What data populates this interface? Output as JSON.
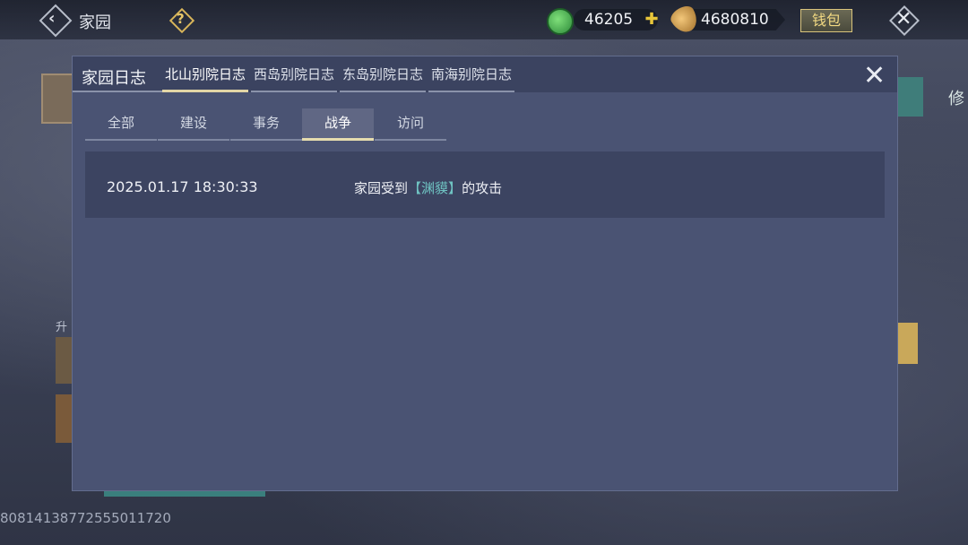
{
  "topbar": {
    "home_title": "家园",
    "jade_amount": "46205",
    "coin_amount": "4680810",
    "wallet_label": "钱包"
  },
  "dialog": {
    "title": "家园日志",
    "top_tabs": [
      {
        "label": "北山别院日志",
        "active": true
      },
      {
        "label": "西岛别院日志",
        "active": false
      },
      {
        "label": "东岛别院日志",
        "active": false
      },
      {
        "label": "南海别院日志",
        "active": false
      }
    ],
    "sub_tabs": [
      {
        "label": "全部",
        "active": false
      },
      {
        "label": "建设",
        "active": false
      },
      {
        "label": "事务",
        "active": false
      },
      {
        "label": "战争",
        "active": true
      },
      {
        "label": "访问",
        "active": false
      }
    ],
    "log_entries": [
      {
        "time": "2025.01.17 18:30:33",
        "prefix": "家园受到",
        "bracket_open": "【",
        "enemy": "渊貘",
        "bracket_close": "】",
        "suffix": "的攻击"
      }
    ]
  },
  "background": {
    "left_label": "升",
    "right_char": "修"
  },
  "footer": {
    "id_text": "8081413877255501172​0"
  },
  "colors": {
    "accent_tab": "#e3d6a6",
    "highlight_name": "#6fc3c2",
    "wallet_gold": "#f2d982"
  }
}
